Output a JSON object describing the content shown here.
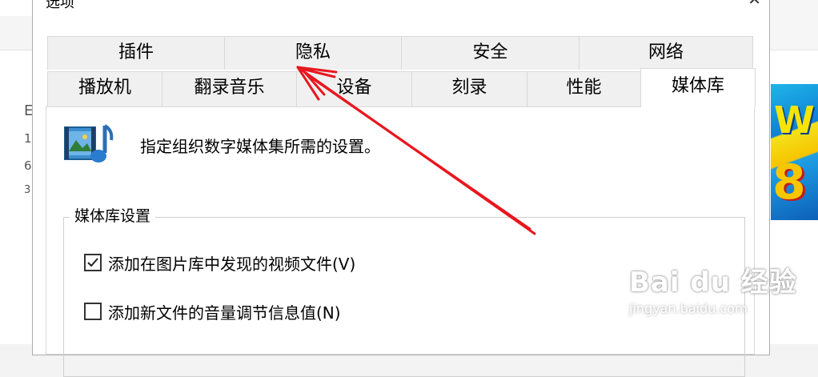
{
  "dialog": {
    "title": "选项",
    "close_glyph": "✕"
  },
  "tabs": {
    "row_top": [
      {
        "label": "插件"
      },
      {
        "label": "隐私"
      },
      {
        "label": "安全"
      },
      {
        "label": "网络"
      }
    ],
    "row_bottom": [
      {
        "label": "播放机"
      },
      {
        "label": "翻录音乐"
      },
      {
        "label": "设备"
      },
      {
        "label": "刻录"
      },
      {
        "label": "性能"
      },
      {
        "label": "媒体库",
        "active": true
      }
    ]
  },
  "library": {
    "description": "指定组织数字媒体集所需的设置。",
    "icon": "media-library-icon",
    "group_title": "媒体库设置",
    "options": [
      {
        "label": "添加在图片库中发现的视频文件(V)",
        "checked": true
      },
      {
        "label": "添加新文件的音量调节信息值(N)",
        "checked": false
      }
    ]
  },
  "watermark": {
    "logo": "Bai du 经验",
    "url": "jingyan.baidu.com"
  },
  "background": {
    "left_fragments": [
      "E",
      "1",
      "6",
      "3"
    ],
    "album_text_1": "W",
    "album_text_2": "8"
  },
  "colors": {
    "annotation_arrow": "#e8171f",
    "tab_inactive": "#f0f0f0",
    "tab_active": "#ffffff"
  }
}
